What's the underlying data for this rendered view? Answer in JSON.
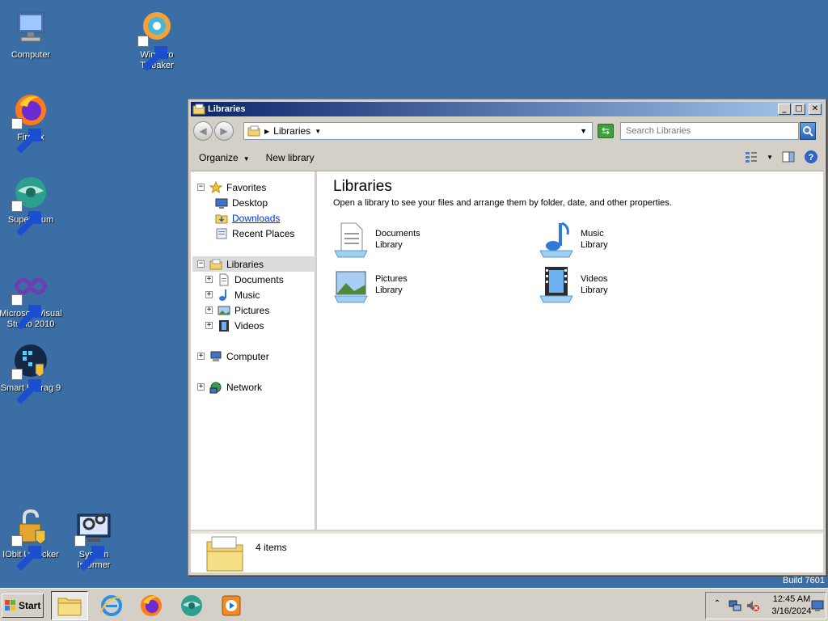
{
  "desktop": {
    "icons": [
      {
        "label": "Computer"
      },
      {
        "label": "Winaero Tweaker"
      },
      {
        "label": "Firefox"
      },
      {
        "label": "Supermium"
      },
      {
        "label": "Microsoft Visual Studio 2010"
      },
      {
        "label": "Smart Defrag 9"
      },
      {
        "label": "IObit Unlocker"
      },
      {
        "label": "System Informer"
      }
    ],
    "build": "Build 7601"
  },
  "window": {
    "title": "Libraries",
    "address": {
      "crumb": "Libraries"
    },
    "search": {
      "placeholder": "Search Libraries"
    },
    "toolbar": {
      "organize": "Organize",
      "new_library": "New library"
    },
    "nav": {
      "favorites": "Favorites",
      "desktop": "Desktop",
      "downloads": "Downloads",
      "recent_places": "Recent Places",
      "libraries": "Libraries",
      "documents": "Documents",
      "music": "Music",
      "pictures": "Pictures",
      "videos": "Videos",
      "computer": "Computer",
      "network": "Network"
    },
    "main": {
      "title": "Libraries",
      "subtitle": "Open a library to see your files and arrange them by folder, date, and other properties.",
      "libraries": [
        {
          "name": "Documents",
          "type": "Library"
        },
        {
          "name": "Music",
          "type": "Library"
        },
        {
          "name": "Pictures",
          "type": "Library"
        },
        {
          "name": "Videos",
          "type": "Library"
        }
      ]
    },
    "details": {
      "count": "4 items"
    }
  },
  "taskbar": {
    "start": "Start",
    "clock": {
      "time": "12:45 AM",
      "date": "3/16/2024"
    }
  }
}
